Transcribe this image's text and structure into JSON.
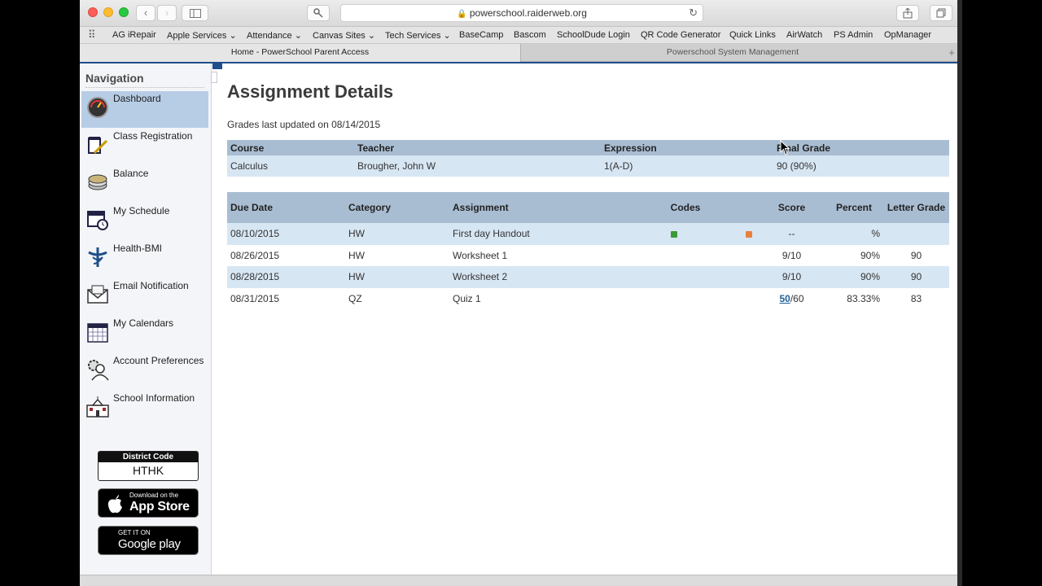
{
  "browser": {
    "url": "powerschool.raiderweb.org",
    "bookmarks": [
      "AG iRepair",
      "Apple Services",
      "Attendance",
      "Canvas Sites",
      "Tech Services",
      "BaseCamp",
      "Bascom",
      "SchoolDude Login",
      "QR Code Generator",
      "Quick Links",
      "AirWatch",
      "PS Admin",
      "OpManager"
    ],
    "tabs": [
      "Home - PowerSchool Parent Access",
      "Powerschool System Management"
    ]
  },
  "sidebar": {
    "title": "Navigation",
    "items": [
      {
        "label": "Dashboard",
        "icon": "dashboard-icon"
      },
      {
        "label": "Class Registration",
        "icon": "class-registration-icon"
      },
      {
        "label": "Balance",
        "icon": "balance-icon"
      },
      {
        "label": "My Schedule",
        "icon": "schedule-icon"
      },
      {
        "label": "Health-BMI",
        "icon": "health-icon"
      },
      {
        "label": "Email Notification",
        "icon": "email-icon"
      },
      {
        "label": "My Calendars",
        "icon": "calendar-icon"
      },
      {
        "label": "Account Preferences",
        "icon": "account-preferences-icon"
      },
      {
        "label": "School Information",
        "icon": "school-icon"
      }
    ],
    "district_code_label": "District Code",
    "district_code": "HTHK",
    "appstore_small": "Download on the",
    "appstore_big": "App Store",
    "googleplay_small": "GET IT ON",
    "googleplay_big": "Google play"
  },
  "main": {
    "title": "Assignment Details",
    "last_updated": "Grades last updated on 08/14/2015",
    "course_table": {
      "headers": [
        "Course",
        "Teacher",
        "Expression",
        "Final Grade"
      ],
      "row": [
        "Calculus",
        "Brougher, John W",
        "1(A-D)",
        "90 (90%)"
      ]
    },
    "assignment_table": {
      "headers": [
        "Due Date",
        "Category",
        "Assignment",
        "Codes",
        "Score",
        "Percent",
        "Letter Grade"
      ],
      "rows": [
        {
          "due": "08/10/2015",
          "category": "HW",
          "assignment": "First day Handout",
          "score": "--",
          "percent": "%",
          "grade": ""
        },
        {
          "due": "08/26/2015",
          "category": "HW",
          "assignment": "Worksheet 1",
          "score": "9/10",
          "percent": "90%",
          "grade": "90"
        },
        {
          "due": "08/28/2015",
          "category": "HW",
          "assignment": "Worksheet 2",
          "score": "9/10",
          "percent": "90%",
          "grade": "90"
        },
        {
          "due": "08/31/2015",
          "category": "QZ",
          "assignment": "Quiz 1",
          "score_link": "50",
          "score_rest": "/60",
          "percent": "83.33%",
          "grade": "83"
        }
      ]
    }
  },
  "colors": {
    "header_blue": "#a9bdd2",
    "row_blue": "#d7e6f3",
    "active_nav": "#b7cde6",
    "code_green": "#3a9a3a",
    "code_orange": "#e8803a"
  }
}
